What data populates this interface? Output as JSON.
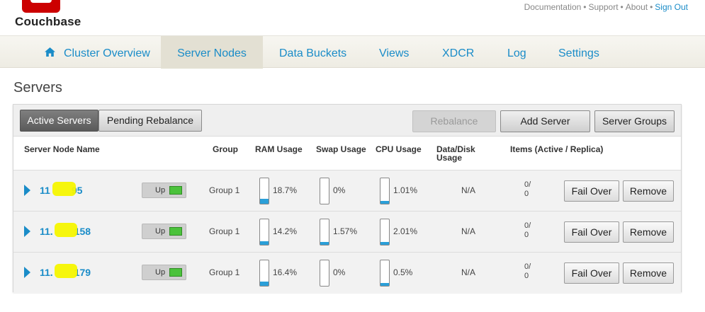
{
  "brand": {
    "name": "Couchbase"
  },
  "top_links": {
    "documentation": "Documentation",
    "support": "Support",
    "about": "About",
    "sign_out": "Sign Out",
    "separator": "•"
  },
  "nav": {
    "items": [
      {
        "label": "Cluster Overview",
        "icon": "home-icon"
      },
      {
        "label": "Server Nodes",
        "active": true
      },
      {
        "label": "Data Buckets"
      },
      {
        "label": "Views"
      },
      {
        "label": "XDCR"
      },
      {
        "label": "Log"
      },
      {
        "label": "Settings"
      }
    ]
  },
  "page": {
    "title": "Servers"
  },
  "toolbar": {
    "active_servers": "Active Servers",
    "pending_rebalance": "Pending Rebalance",
    "rebalance": "Rebalance",
    "add_server": "Add Server",
    "server_groups": "Server Groups"
  },
  "columns": {
    "name": "Server Node Name",
    "group": "Group",
    "ram": "RAM Usage",
    "swap": "Swap Usage",
    "cpu": "CPU Usage",
    "data_disk_1": "Data/Disk",
    "data_disk_2": "Usage",
    "items": "Items (Active / Replica)"
  },
  "rows": [
    {
      "name_start": "11",
      "name_end": "95",
      "status": "Up",
      "group": "Group 1",
      "ram": "18.7%",
      "ram_level": 0.187,
      "swap": "0%",
      "swap_level": 0,
      "cpu": "1.01%",
      "cpu_level": 0.0101,
      "data_disk": "N/A",
      "items_active": "0/",
      "items_replica": "0",
      "fail_over": "Fail Over",
      "remove": "Remove"
    },
    {
      "name_start": "11.",
      "name_end": "158",
      "status": "Up",
      "group": "Group 1",
      "ram": "14.2%",
      "ram_level": 0.142,
      "swap": "1.57%",
      "swap_level": 0.0157,
      "cpu": "2.01%",
      "cpu_level": 0.0201,
      "data_disk": "N/A",
      "items_active": "0/",
      "items_replica": "0",
      "fail_over": "Fail Over",
      "remove": "Remove"
    },
    {
      "name_start": "11.",
      "name_end": "179",
      "status": "Up",
      "group": "Group 1",
      "ram": "16.4%",
      "ram_level": 0.164,
      "swap": "0%",
      "swap_level": 0,
      "cpu": "0.5%",
      "cpu_level": 0.005,
      "data_disk": "N/A",
      "items_active": "0/",
      "items_replica": "0",
      "fail_over": "Fail Over",
      "remove": "Remove"
    }
  ],
  "colors": {
    "accent": "#1a8cc8",
    "logo": "#cc0000",
    "meter_fill": "#2b9fd8",
    "status_led": "#4bc23b",
    "redaction": "#f5f500"
  }
}
